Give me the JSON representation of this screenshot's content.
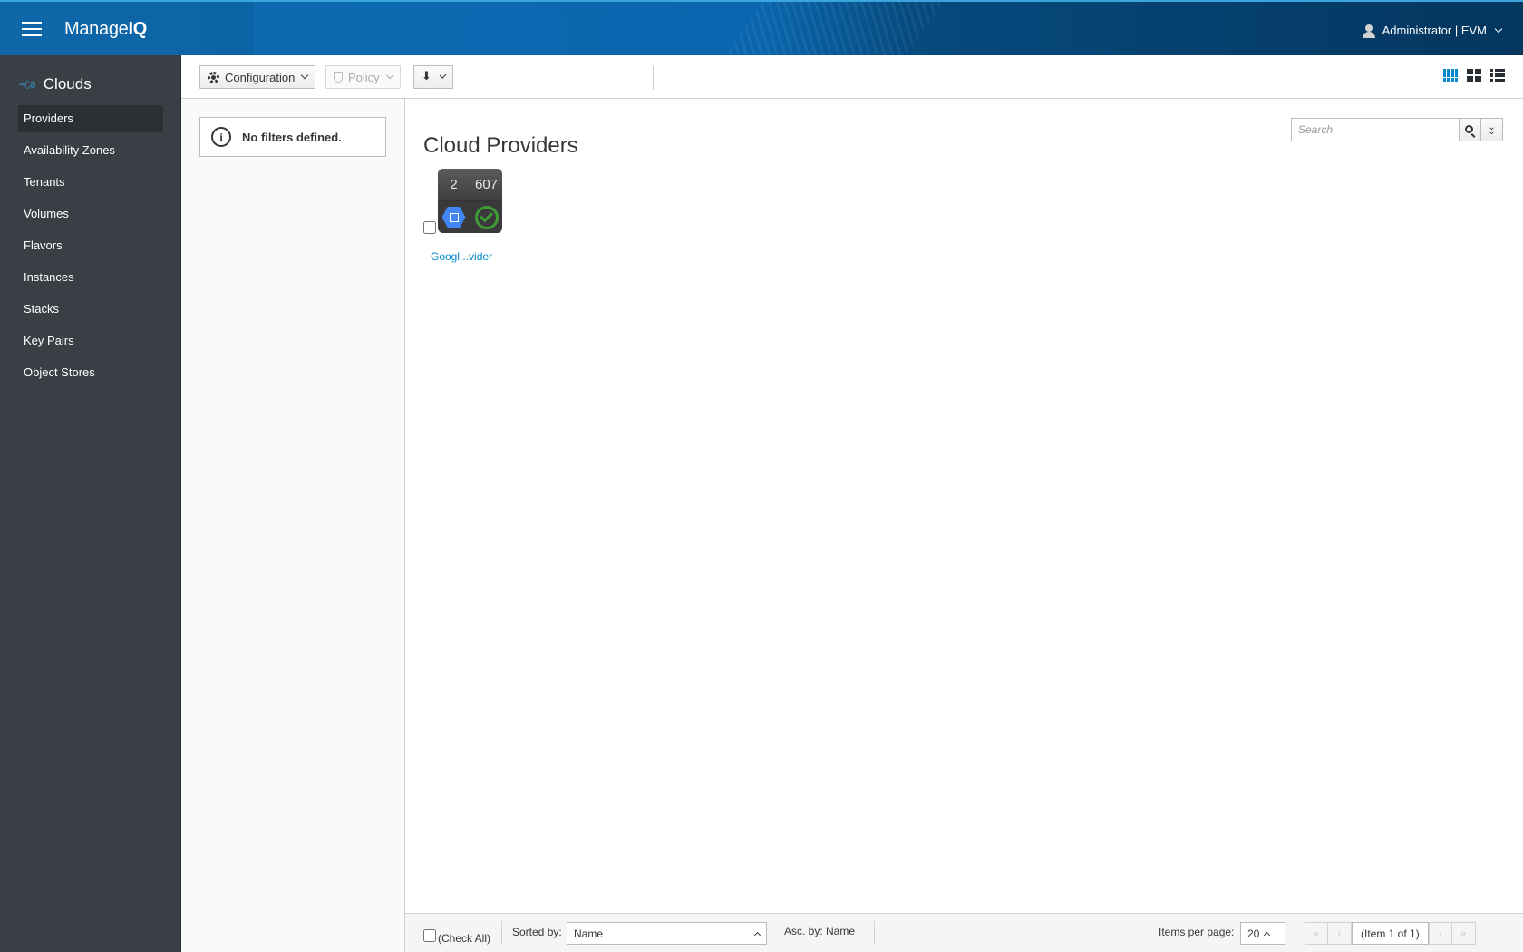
{
  "header": {
    "brand_prefix": "Manage",
    "brand_suffix": "IQ",
    "user_label": "Administrator | EVM"
  },
  "sidebar": {
    "title": "Clouds",
    "items": [
      {
        "label": "Providers",
        "active": true
      },
      {
        "label": "Availability Zones"
      },
      {
        "label": "Tenants"
      },
      {
        "label": "Volumes"
      },
      {
        "label": "Flavors"
      },
      {
        "label": "Instances"
      },
      {
        "label": "Stacks"
      },
      {
        "label": "Key Pairs"
      },
      {
        "label": "Object Stores"
      }
    ]
  },
  "toolbar": {
    "configuration_label": "Configuration",
    "policy_label": "Policy",
    "views": [
      "grid-view",
      "tile-view",
      "list-view"
    ],
    "active_view": "grid-view"
  },
  "filters": {
    "message": "No filters defined."
  },
  "main": {
    "title": "Cloud Providers",
    "search_placeholder": "Search",
    "tiles": [
      {
        "label": "Googl...vider",
        "top_left": "2",
        "top_right": "607",
        "bottom_left_icon": "google-cloud-icon",
        "bottom_right_icon": "valid-status-icon"
      }
    ]
  },
  "footer": {
    "check_all_label": "(Check All)",
    "sorted_by_label": "Sorted by:",
    "sort_value": "Name",
    "asc_by_label": "Asc. by: Name",
    "items_per_page_label": "Items per page:",
    "items_per_page_value": "20",
    "page_info": "(Item 1 of 1)"
  },
  "colors": {
    "header_blue": "#0f6db3",
    "sidebar_bg": "#393f44",
    "link_blue": "#0088ce",
    "ok_green": "#3f9c35"
  }
}
